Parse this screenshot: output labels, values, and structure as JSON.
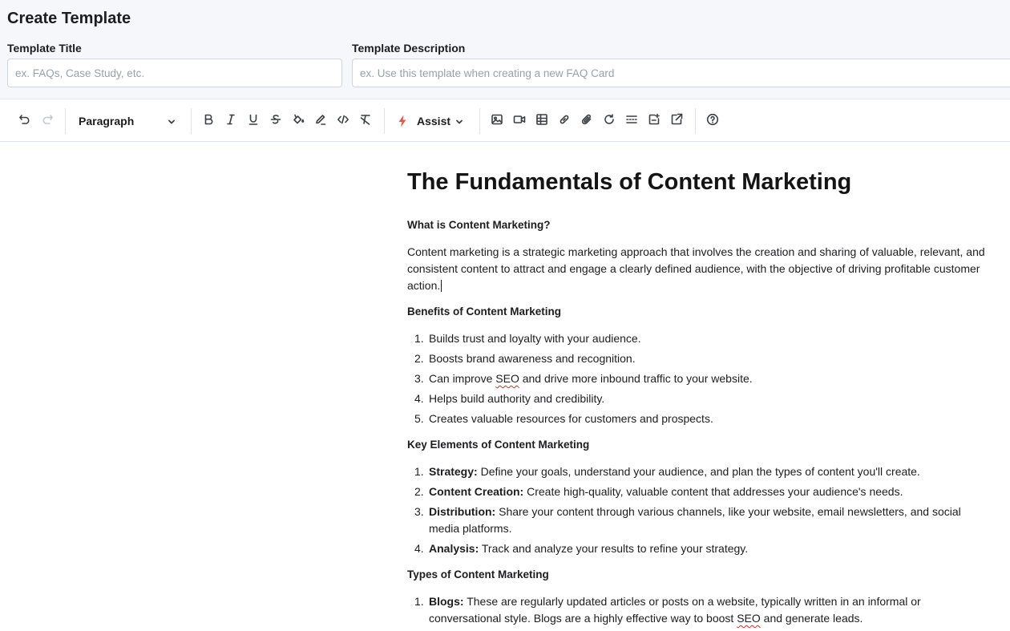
{
  "header": {
    "title": "Create Template",
    "template_title_label": "Template Title",
    "template_title_placeholder": "ex. FAQs, Case Study, etc.",
    "template_title_value": "",
    "template_description_label": "Template Description",
    "template_description_placeholder": "ex. Use this template when creating a new FAQ Card",
    "template_description_value": ""
  },
  "toolbar": {
    "block_format": "Paragraph",
    "assist_label": "Assist",
    "accent_color": "#e8553f",
    "icons": [
      "undo-icon",
      "redo-icon",
      "bold-icon",
      "italic-icon",
      "underline-icon",
      "strikethrough-icon",
      "highlight-color-icon",
      "pen-icon",
      "code-icon",
      "clear-format-icon",
      "assist-bolt-icon",
      "image-icon",
      "video-icon",
      "table-icon",
      "link-icon",
      "attachment-icon",
      "refresh-icon",
      "divider-icon",
      "insert-snippet-icon",
      "external-edit-icon",
      "help-icon"
    ]
  },
  "document": {
    "title": "The Fundamentals of Content Marketing",
    "section1": {
      "heading": "What is Content Marketing?",
      "paragraph": "Content marketing is a strategic marketing approach that involves the creation and sharing of valuable, relevant, and consistent content to attract and engage a clearly defined audience, with the objective of driving profitable customer action."
    },
    "section2": {
      "heading": "Benefits of Content Marketing",
      "items": [
        "Builds trust and loyalty with your audience.",
        "Boosts brand awareness and recognition.",
        "Can improve SEO and drive more inbound traffic to your website.",
        "Helps build authority and credibility.",
        "Creates valuable resources for customers and prospects."
      ]
    },
    "section3": {
      "heading": "Key Elements of Content Marketing",
      "items": [
        {
          "term": "Strategy:",
          "text": " Define your goals, understand your audience, and plan the types of content you'll create."
        },
        {
          "term": "Content Creation:",
          "text": " Create high-quality, valuable content that addresses your audience's needs."
        },
        {
          "term": "Distribution:",
          "text": " Share your content through various channels, like your website, email newsletters, and social media platforms."
        },
        {
          "term": "Analysis:",
          "text": " Track and analyze your results to refine your strategy."
        }
      ]
    },
    "section4": {
      "heading": "Types of Content Marketing",
      "items": [
        {
          "term": "Blogs:",
          "text": " These are regularly updated articles or posts on a website, typically written in an informal or conversational style. Blogs are a highly effective way to boost SEO and generate leads."
        }
      ]
    }
  }
}
